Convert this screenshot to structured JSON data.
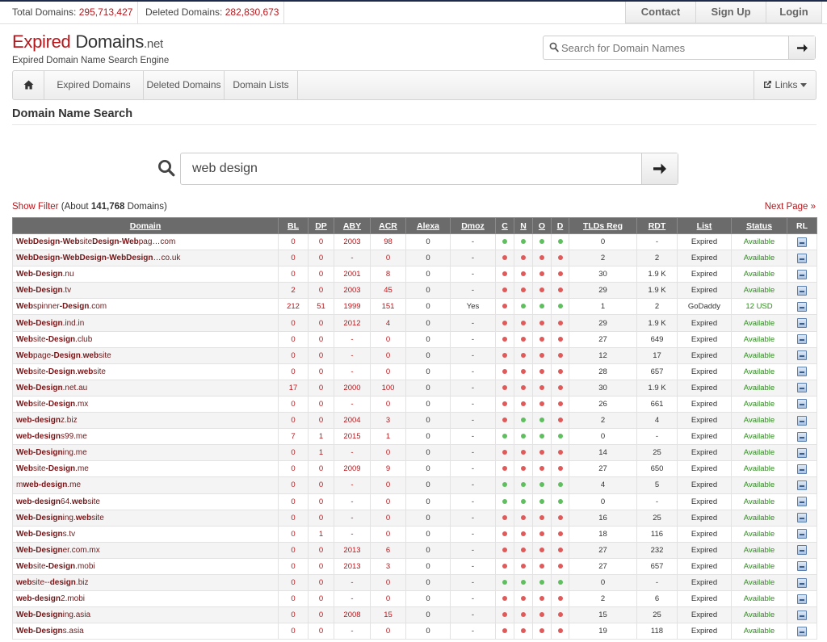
{
  "stats": {
    "total_label": "Total Domains:",
    "total_value": "295,713,427",
    "deleted_label": "Deleted Domains:",
    "deleted_value": "282,830,673"
  },
  "topnav": {
    "contact": "Contact",
    "signup": "Sign Up",
    "login": "Login"
  },
  "logo": {
    "expired": "Expired",
    "domains": "Domains",
    "tld": ".net",
    "tagline": "Expired Domain Name Search Engine"
  },
  "header_search": {
    "placeholder": "Search for Domain Names"
  },
  "mainnav": {
    "expired": "Expired Domains",
    "deleted": "Deleted Domains",
    "lists": "Domain Lists",
    "links": "Links"
  },
  "page_title": "Domain Name Search",
  "search": {
    "value": "web design"
  },
  "filter": {
    "show_filter": "Show Filter",
    "about_prefix": "(About",
    "count": "141,768",
    "about_suffix": "Domains)",
    "next_page": "Next Page »"
  },
  "colors": {
    "accent": "#b8161b",
    "available": "#2e8b1e",
    "dot_red": "#e05a5a",
    "dot_green": "#5fbf5f"
  },
  "table": {
    "columns": [
      "Domain",
      "BL",
      "DP",
      "ABY",
      "ACR",
      "Alexa",
      "Dmoz",
      "C",
      "N",
      "O",
      "D",
      "TLDs Reg",
      "RDT",
      "List",
      "Status",
      "RL"
    ],
    "rows": [
      {
        "parts": [
          [
            "b",
            "WebDesign"
          ],
          [
            "b",
            "-"
          ],
          [
            "b",
            "Web"
          ],
          [
            "n",
            "site"
          ],
          [
            "b",
            "Design"
          ],
          [
            "b",
            "-"
          ],
          [
            "b",
            "Web"
          ],
          [
            "n",
            "pag…com"
          ]
        ],
        "bl": "0",
        "dp": "0",
        "aby": "2003",
        "acr": "98",
        "alexa": "0",
        "dmoz": "-",
        "c": "g",
        "n": "g",
        "o": "g",
        "d": "g",
        "tlds": "0",
        "rdt": "-",
        "list": "Expired",
        "status": "Available"
      },
      {
        "parts": [
          [
            "b",
            "WebDesign"
          ],
          [
            "b",
            "-"
          ],
          [
            "b",
            "WebDesign"
          ],
          [
            "b",
            "-"
          ],
          [
            "b",
            "WebDesign"
          ],
          [
            "n",
            "…co.uk"
          ]
        ],
        "bl": "0",
        "dp": "0",
        "aby": "-",
        "acr": "0",
        "alexa": "0",
        "dmoz": "-",
        "c": "r",
        "n": "r",
        "o": "r",
        "d": "r",
        "tlds": "2",
        "rdt": "2",
        "list": "Expired",
        "status": "Available"
      },
      {
        "parts": [
          [
            "b",
            "Web-Design"
          ],
          [
            "n",
            ".nu"
          ]
        ],
        "bl": "0",
        "dp": "0",
        "aby": "2001",
        "acr": "8",
        "alexa": "0",
        "dmoz": "-",
        "c": "r",
        "n": "r",
        "o": "r",
        "d": "r",
        "tlds": "30",
        "rdt": "1.9 K",
        "list": "Expired",
        "status": "Available"
      },
      {
        "parts": [
          [
            "b",
            "Web-Design"
          ],
          [
            "n",
            ".tv"
          ]
        ],
        "bl": "2",
        "dp": "0",
        "aby": "2003",
        "acr": "45",
        "alexa": "0",
        "dmoz": "-",
        "c": "r",
        "n": "r",
        "o": "r",
        "d": "r",
        "tlds": "29",
        "rdt": "1.9 K",
        "list": "Expired",
        "status": "Available"
      },
      {
        "parts": [
          [
            "b",
            "Web"
          ],
          [
            "n",
            "spinner"
          ],
          [
            "b",
            "-Design"
          ],
          [
            "n",
            ".com"
          ]
        ],
        "bl": "212",
        "dp": "51",
        "aby": "1999",
        "acr": "151",
        "alexa": "0",
        "dmoz": "Yes",
        "c": "r",
        "n": "g",
        "o": "g",
        "d": "g",
        "tlds": "1",
        "rdt": "2",
        "list": "GoDaddy",
        "status": "12 USD"
      },
      {
        "parts": [
          [
            "b",
            "Web-Design"
          ],
          [
            "n",
            ".ind.in"
          ]
        ],
        "bl": "0",
        "dp": "0",
        "aby": "2012",
        "acr": "4",
        "alexa": "0",
        "dmoz": "-",
        "c": "r",
        "n": "r",
        "o": "r",
        "d": "r",
        "tlds": "29",
        "rdt": "1.9 K",
        "list": "Expired",
        "status": "Available"
      },
      {
        "parts": [
          [
            "b",
            "Web"
          ],
          [
            "n",
            "site"
          ],
          [
            "b",
            "-Design"
          ],
          [
            "n",
            ".club"
          ]
        ],
        "bl": "0",
        "dp": "0",
        "aby": "-",
        "acr": "0",
        "alexa": "0",
        "dmoz": "-",
        "c": "r",
        "n": "r",
        "o": "r",
        "d": "r",
        "tlds": "27",
        "rdt": "649",
        "list": "Expired",
        "status": "Available"
      },
      {
        "parts": [
          [
            "b",
            "Web"
          ],
          [
            "n",
            "page"
          ],
          [
            "b",
            "-Design"
          ],
          [
            "n",
            "."
          ],
          [
            "b",
            "web"
          ],
          [
            "n",
            "site"
          ]
        ],
        "bl": "0",
        "dp": "0",
        "aby": "-",
        "acr": "0",
        "alexa": "0",
        "dmoz": "-",
        "c": "r",
        "n": "r",
        "o": "r",
        "d": "r",
        "tlds": "12",
        "rdt": "17",
        "list": "Expired",
        "status": "Available"
      },
      {
        "parts": [
          [
            "b",
            "Web"
          ],
          [
            "n",
            "site"
          ],
          [
            "b",
            "-Design"
          ],
          [
            "n",
            "."
          ],
          [
            "b",
            "web"
          ],
          [
            "n",
            "site"
          ]
        ],
        "bl": "0",
        "dp": "0",
        "aby": "-",
        "acr": "0",
        "alexa": "0",
        "dmoz": "-",
        "c": "r",
        "n": "r",
        "o": "r",
        "d": "r",
        "tlds": "28",
        "rdt": "657",
        "list": "Expired",
        "status": "Available"
      },
      {
        "parts": [
          [
            "b",
            "Web-Design"
          ],
          [
            "n",
            ".net.au"
          ]
        ],
        "bl": "17",
        "dp": "0",
        "aby": "2000",
        "acr": "100",
        "alexa": "0",
        "dmoz": "-",
        "c": "r",
        "n": "r",
        "o": "r",
        "d": "r",
        "tlds": "30",
        "rdt": "1.9 K",
        "list": "Expired",
        "status": "Available"
      },
      {
        "parts": [
          [
            "b",
            "Web"
          ],
          [
            "n",
            "site"
          ],
          [
            "b",
            "-Design"
          ],
          [
            "n",
            ".mx"
          ]
        ],
        "bl": "0",
        "dp": "0",
        "aby": "-",
        "acr": "0",
        "alexa": "0",
        "dmoz": "-",
        "c": "r",
        "n": "r",
        "o": "r",
        "d": "r",
        "tlds": "26",
        "rdt": "661",
        "list": "Expired",
        "status": "Available"
      },
      {
        "parts": [
          [
            "b",
            "web-design"
          ],
          [
            "n",
            "z.biz"
          ]
        ],
        "bl": "0",
        "dp": "0",
        "aby": "2004",
        "acr": "3",
        "alexa": "0",
        "dmoz": "-",
        "c": "r",
        "n": "g",
        "o": "g",
        "d": "r",
        "tlds": "2",
        "rdt": "4",
        "list": "Expired",
        "status": "Available"
      },
      {
        "parts": [
          [
            "b",
            "web-design"
          ],
          [
            "n",
            "s99.me"
          ]
        ],
        "bl": "7",
        "dp": "1",
        "aby": "2015",
        "acr": "1",
        "alexa": "0",
        "dmoz": "-",
        "c": "g",
        "n": "g",
        "o": "g",
        "d": "g",
        "tlds": "0",
        "rdt": "-",
        "list": "Expired",
        "status": "Available"
      },
      {
        "parts": [
          [
            "b",
            "Web-Design"
          ],
          [
            "n",
            "ing.me"
          ]
        ],
        "bl": "0",
        "dp": "1",
        "aby": "-",
        "acr": "0",
        "alexa": "0",
        "dmoz": "-",
        "c": "r",
        "n": "r",
        "o": "r",
        "d": "r",
        "tlds": "14",
        "rdt": "25",
        "list": "Expired",
        "status": "Available"
      },
      {
        "parts": [
          [
            "b",
            "Web"
          ],
          [
            "n",
            "site"
          ],
          [
            "b",
            "-Design"
          ],
          [
            "n",
            ".me"
          ]
        ],
        "bl": "0",
        "dp": "0",
        "aby": "2009",
        "acr": "9",
        "alexa": "0",
        "dmoz": "-",
        "c": "r",
        "n": "r",
        "o": "r",
        "d": "r",
        "tlds": "27",
        "rdt": "650",
        "list": "Expired",
        "status": "Available"
      },
      {
        "parts": [
          [
            "n",
            "m"
          ],
          [
            "b",
            "web-design"
          ],
          [
            "n",
            ".me"
          ]
        ],
        "bl": "0",
        "dp": "0",
        "aby": "-",
        "acr": "0",
        "alexa": "0",
        "dmoz": "-",
        "c": "g",
        "n": "g",
        "o": "g",
        "d": "g",
        "tlds": "4",
        "rdt": "5",
        "list": "Expired",
        "status": "Available"
      },
      {
        "parts": [
          [
            "b",
            "web-design"
          ],
          [
            "n",
            "64."
          ],
          [
            "b",
            "web"
          ],
          [
            "n",
            "site"
          ]
        ],
        "bl": "0",
        "dp": "0",
        "aby": "-",
        "acr": "0",
        "alexa": "0",
        "dmoz": "-",
        "c": "g",
        "n": "g",
        "o": "g",
        "d": "g",
        "tlds": "0",
        "rdt": "-",
        "list": "Expired",
        "status": "Available"
      },
      {
        "parts": [
          [
            "b",
            "Web-Design"
          ],
          [
            "n",
            "ing."
          ],
          [
            "b",
            "web"
          ],
          [
            "n",
            "site"
          ]
        ],
        "bl": "0",
        "dp": "0",
        "aby": "-",
        "acr": "0",
        "alexa": "0",
        "dmoz": "-",
        "c": "r",
        "n": "r",
        "o": "r",
        "d": "r",
        "tlds": "16",
        "rdt": "25",
        "list": "Expired",
        "status": "Available"
      },
      {
        "parts": [
          [
            "b",
            "Web-Design"
          ],
          [
            "n",
            "s.tv"
          ]
        ],
        "bl": "0",
        "dp": "1",
        "aby": "-",
        "acr": "0",
        "alexa": "0",
        "dmoz": "-",
        "c": "r",
        "n": "r",
        "o": "r",
        "d": "r",
        "tlds": "18",
        "rdt": "116",
        "list": "Expired",
        "status": "Available"
      },
      {
        "parts": [
          [
            "b",
            "Web-Design"
          ],
          [
            "n",
            "er.com.mx"
          ]
        ],
        "bl": "0",
        "dp": "0",
        "aby": "2013",
        "acr": "6",
        "alexa": "0",
        "dmoz": "-",
        "c": "r",
        "n": "r",
        "o": "r",
        "d": "r",
        "tlds": "27",
        "rdt": "232",
        "list": "Expired",
        "status": "Available"
      },
      {
        "parts": [
          [
            "b",
            "Web"
          ],
          [
            "n",
            "site"
          ],
          [
            "b",
            "-Design"
          ],
          [
            "n",
            ".mobi"
          ]
        ],
        "bl": "0",
        "dp": "0",
        "aby": "2013",
        "acr": "3",
        "alexa": "0",
        "dmoz": "-",
        "c": "r",
        "n": "r",
        "o": "r",
        "d": "r",
        "tlds": "27",
        "rdt": "657",
        "list": "Expired",
        "status": "Available"
      },
      {
        "parts": [
          [
            "b",
            "web"
          ],
          [
            "n",
            "site--"
          ],
          [
            "b",
            "design"
          ],
          [
            "n",
            ".biz"
          ]
        ],
        "bl": "0",
        "dp": "0",
        "aby": "-",
        "acr": "0",
        "alexa": "0",
        "dmoz": "-",
        "c": "g",
        "n": "g",
        "o": "g",
        "d": "g",
        "tlds": "0",
        "rdt": "-",
        "list": "Expired",
        "status": "Available"
      },
      {
        "parts": [
          [
            "b",
            "web-design"
          ],
          [
            "n",
            "2.mobi"
          ]
        ],
        "bl": "0",
        "dp": "0",
        "aby": "-",
        "acr": "0",
        "alexa": "0",
        "dmoz": "-",
        "c": "r",
        "n": "r",
        "o": "r",
        "d": "r",
        "tlds": "2",
        "rdt": "6",
        "list": "Expired",
        "status": "Available"
      },
      {
        "parts": [
          [
            "b",
            "Web-Design"
          ],
          [
            "n",
            "ing.asia"
          ]
        ],
        "bl": "0",
        "dp": "0",
        "aby": "2008",
        "acr": "15",
        "alexa": "0",
        "dmoz": "-",
        "c": "r",
        "n": "r",
        "o": "r",
        "d": "r",
        "tlds": "15",
        "rdt": "25",
        "list": "Expired",
        "status": "Available"
      },
      {
        "parts": [
          [
            "b",
            "Web-Design"
          ],
          [
            "n",
            "s.asia"
          ]
        ],
        "bl": "0",
        "dp": "0",
        "aby": "-",
        "acr": "0",
        "alexa": "0",
        "dmoz": "-",
        "c": "r",
        "n": "r",
        "o": "r",
        "d": "r",
        "tlds": "19",
        "rdt": "118",
        "list": "Expired",
        "status": "Available"
      }
    ]
  }
}
